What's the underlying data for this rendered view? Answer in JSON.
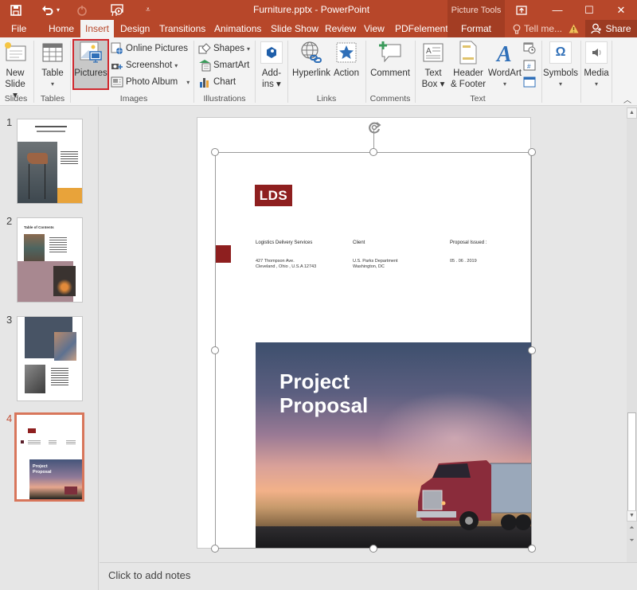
{
  "window": {
    "title": "Furniture.pptx - PowerPoint",
    "context_label": "Picture Tools",
    "controls": {
      "ribbon_display": "ribbon-display-icon",
      "minimize": "—",
      "maximize": "☐",
      "close": "✕"
    }
  },
  "quick_access": [
    {
      "name": "save-icon",
      "glyph": "💾"
    },
    {
      "name": "undo-icon",
      "glyph": "↶"
    },
    {
      "name": "redo-icon",
      "glyph": "↻"
    },
    {
      "name": "present-from-start-icon",
      "glyph": "▣"
    },
    {
      "name": "customize-qat-icon",
      "glyph": "▾"
    }
  ],
  "tabs": [
    {
      "label": "File"
    },
    {
      "label": "Home"
    },
    {
      "label": "Insert",
      "active": true
    },
    {
      "label": "Design"
    },
    {
      "label": "Transitions"
    },
    {
      "label": "Animations"
    },
    {
      "label": "Slide Show"
    },
    {
      "label": "Review"
    },
    {
      "label": "View"
    },
    {
      "label": "PDFelement"
    },
    {
      "label": "Format",
      "contextual": true
    }
  ],
  "tell_me": "Tell me...",
  "share_label": "Share",
  "ribbon": {
    "groups": {
      "slides": "Slides",
      "tables": "Tables",
      "images": "Images",
      "illustrations": "Illustrations",
      "links": "Links",
      "comments": "Comments",
      "text": "Text"
    },
    "new_slide": [
      "New",
      "Slide ▾"
    ],
    "table": "Table",
    "pictures": "Pictures",
    "online_pictures": "Online Pictures",
    "screenshot": "Screenshot",
    "photo_album": "Photo Album",
    "shapes": "Shapes",
    "smartart": "SmartArt",
    "chart": "Chart",
    "addins": [
      "Add-",
      "ins ▾"
    ],
    "hyperlink": "Hyperlink",
    "action": "Action",
    "comment": "Comment",
    "text_box": [
      "Text",
      "Box ▾"
    ],
    "header_footer": [
      "Header",
      "& Footer"
    ],
    "wordart": "WordArt",
    "symbols": "Symbols",
    "media": "Media"
  },
  "thumbnails": [
    {
      "number": "1"
    },
    {
      "number": "2",
      "title": "Table of Contents"
    },
    {
      "number": "3"
    },
    {
      "number": "4",
      "active": true,
      "title": "Project Proposal"
    }
  ],
  "slide": {
    "logo": "LDS",
    "company_heading": "Logistics Delivery Services",
    "company_address": [
      "427 Thompson Ave.",
      "Cleveland , Ohio , U.S.A 12743"
    ],
    "client_heading": "Client",
    "client_details": [
      "U.S. Parks Department",
      "Washington, DC"
    ],
    "issued_heading": "Proposal Issued :",
    "issued_date": "05 . 06 . 2019",
    "photo_title": [
      "Project",
      "Proposal"
    ]
  },
  "notes_placeholder": "Click to add notes",
  "colors": {
    "accent": "#b7472a",
    "brand_red": "#8e1f1f",
    "selection_outline": "#d0282e",
    "active_thumb_border": "#d8765b"
  }
}
